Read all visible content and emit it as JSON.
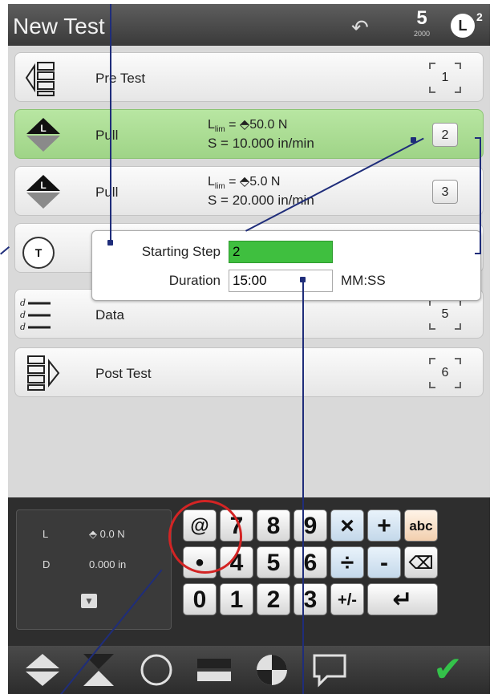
{
  "header": {
    "title": "New Test",
    "count_big": "5",
    "count_small": "2000",
    "logo_letter": "L",
    "logo_sup": "2"
  },
  "steps": [
    {
      "name": "Pre Test",
      "line1": "",
      "line2": "",
      "num": "1",
      "icon": "pre-test-icon"
    },
    {
      "name": "Pull",
      "line1": "L",
      "line1_sub": "lim",
      "line1_val": "= ⬘50.0 N",
      "line2": "S = 10.000 in/min",
      "num": "2",
      "icon": "pull-icon"
    },
    {
      "name": "Pull",
      "line1": "L",
      "line1_sub": "lim",
      "line1_val": "= ⬘5.0 N",
      "line2": "S = 20.000 in/min",
      "num": "3",
      "icon": "pull-icon"
    },
    {
      "name": "Data",
      "line1": "",
      "line2": "",
      "num": "5",
      "icon": "data-icon"
    },
    {
      "name": "Post Test",
      "line1": "",
      "line2": "",
      "num": "6",
      "icon": "post-test-icon"
    }
  ],
  "popup": {
    "starting_step_label": "Starting Step",
    "starting_step_value": "2",
    "duration_label": "Duration",
    "duration_value": "15:00",
    "duration_unit": "MM:SS",
    "timer_glyph": "T"
  },
  "readout": {
    "l_label": "L",
    "l_value": "⬘ 0.0 N",
    "d_label": "D",
    "d_value": "0.000 in"
  },
  "keypad": {
    "row1": [
      "@",
      "7",
      "8",
      "9",
      "×",
      "+",
      "abc"
    ],
    "row2": [
      "•",
      "4",
      "5",
      "6",
      "÷",
      "-",
      "⌫"
    ],
    "row3": [
      "0",
      "1",
      "2",
      "3",
      "+/-",
      "↵"
    ]
  },
  "colors": {
    "active_step": "#a9dc92",
    "starting_step_field": "#3fbf3f",
    "annotation": "#1f2d7a",
    "highlight_circle": "#d32424",
    "confirm": "#34c24a"
  }
}
